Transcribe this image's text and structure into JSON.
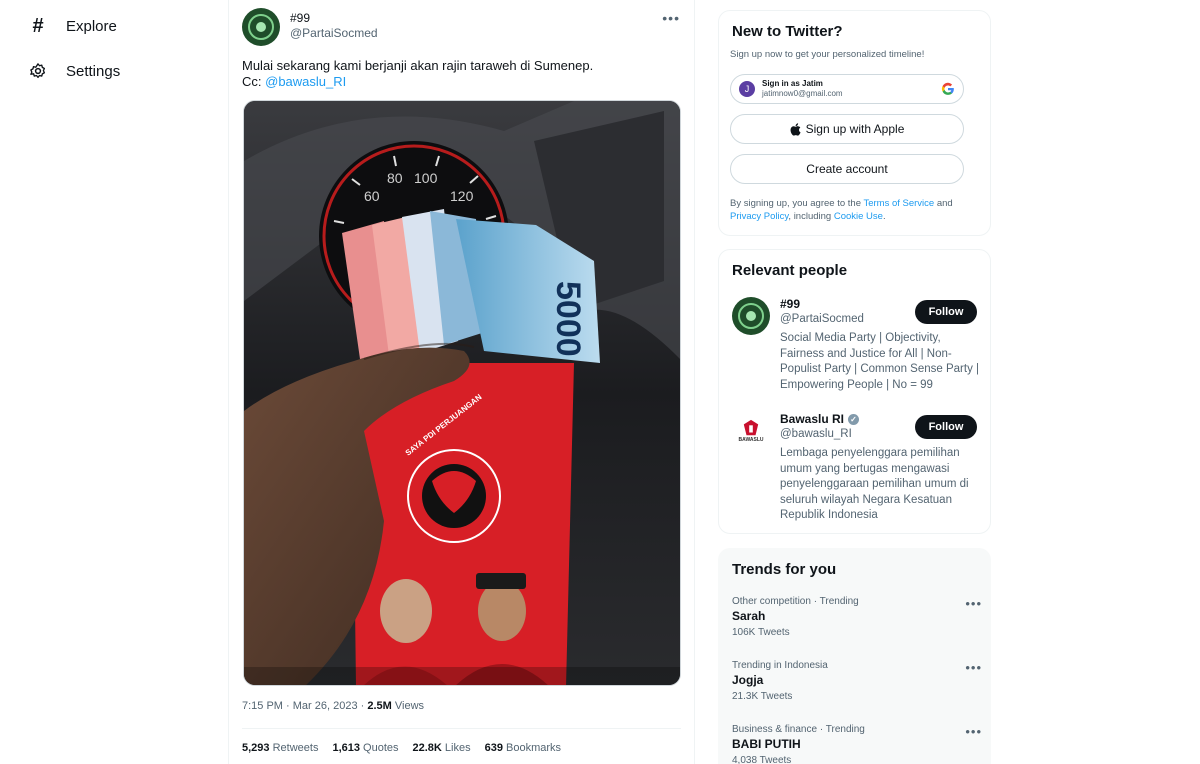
{
  "nav": {
    "explore": {
      "label": "Explore",
      "icon": "hashtag-icon"
    },
    "settings": {
      "label": "Settings",
      "icon": "gear-icon"
    }
  },
  "tweet": {
    "display_name": "#99",
    "handle": "@PartaiSocmed",
    "text_line1": "Mulai sekarang kami berjanji akan rajin taraweh di Sumenep.",
    "text_line2_prefix": "Cc: ",
    "mention": "@bawaslu_RI",
    "timestamp": "7:15 PM · Mar 26, 2023 · ",
    "views_count": "2.5M",
    "views_label": " Views",
    "stats": {
      "retweets_count": "5,293",
      "retweets_label": " Retweets",
      "quotes_count": "1,613",
      "quotes_label": " Quotes",
      "likes_count": "22.8K",
      "likes_label": " Likes",
      "bookmarks_count": "639",
      "bookmarks_label": " Bookmarks"
    },
    "media": {
      "speedo_marks": [
        "60",
        "80",
        "100",
        "120"
      ],
      "banknote_label": "5000",
      "envelope_text": "SAYA PDI PERJUANGAN"
    }
  },
  "signup": {
    "title": "New to Twitter?",
    "subtitle": "Sign up now to get your personalized timeline!",
    "google_line1": "Sign in as Jatim",
    "google_line2": "jatimnow0@gmail.com",
    "google_initial": "J",
    "apple_label": "Sign up with Apple",
    "create_label": "Create account",
    "terms_prefix": "By signing up, you agree to the ",
    "terms_link": "Terms of Service",
    "terms_and": " and ",
    "privacy_link": "Privacy Policy",
    "terms_including": ", including ",
    "cookie_link": "Cookie Use",
    "terms_end": "."
  },
  "relevant": {
    "title": "Relevant people",
    "people": [
      {
        "name": "#99",
        "handle": "@PartaiSocmed",
        "bio": "Social Media Party | Objectivity, Fairness and Justice for All | Non-Populist Party | Common Sense Party | Empowering People | No = 99",
        "follow_label": "Follow"
      },
      {
        "name": "Bawaslu RI",
        "handle": "@bawaslu_RI",
        "bio": "Lembaga penyelenggara pemilihan umum yang bertugas mengawasi penyelenggaraan pemilihan umum di seluruh wilayah Negara Kesatuan Republik Indonesia",
        "follow_label": "Follow",
        "logo_text": "BAWASLU"
      }
    ]
  },
  "trends": {
    "title": "Trends for you",
    "items": [
      {
        "context": "Other competition · Trending",
        "name": "Sarah",
        "count": "106K Tweets"
      },
      {
        "context": "Trending in Indonesia",
        "name": "Jogja",
        "count": "21.3K Tweets"
      },
      {
        "context": "Business & finance · Trending",
        "name": "BABI PUTIH",
        "count": "4,038 Tweets"
      }
    ]
  },
  "colors": {
    "accent": "#1d9bf0",
    "text_primary": "#0f1419",
    "text_secondary": "#536471",
    "envelope_red": "#d71f26"
  }
}
